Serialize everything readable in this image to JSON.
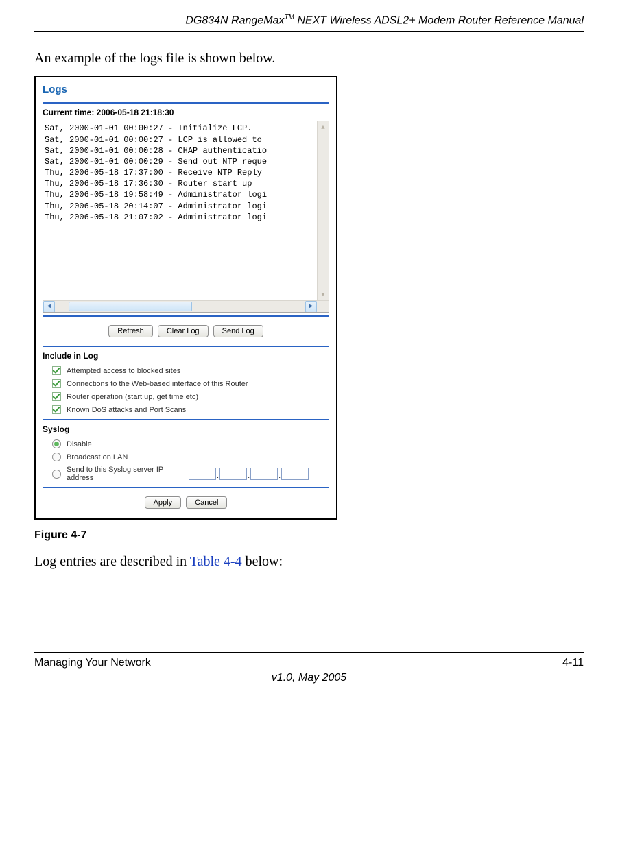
{
  "header": {
    "title_pre": "DG834N RangeMax",
    "title_tm": "TM",
    "title_post": " NEXT Wireless ADSL2+ Modem Router Reference Manual"
  },
  "intro_text": "An example of the logs file is shown below.",
  "panel": {
    "title": "Logs",
    "current_time_label": "Current time: 2006-05-18 21:18:30",
    "log_lines": [
      "Sat, 2000-01-01 00:00:27 - Initialize LCP.",
      "Sat, 2000-01-01 00:00:27 - LCP is allowed to",
      "Sat, 2000-01-01 00:00:28 - CHAP authenticatio",
      "Sat, 2000-01-01 00:00:29 - Send out NTP reque",
      "Thu, 2006-05-18 17:37:00 - Receive NTP Reply",
      "Thu, 2006-05-18 17:36:30 - Router start up",
      "Thu, 2006-05-18 19:58:49 - Administrator logi",
      "Thu, 2006-05-18 20:14:07 - Administrator logi",
      "Thu, 2006-05-18 21:07:02 - Administrator logi"
    ],
    "buttons": {
      "refresh": "Refresh",
      "clear": "Clear Log",
      "send": "Send Log"
    },
    "include_label": "Include in Log",
    "include_options": [
      "Attempted access to blocked sites",
      "Connections to the Web-based interface of this Router",
      "Router operation (start up, get time etc)",
      "Known DoS attacks and Port Scans"
    ],
    "syslog_label": "Syslog",
    "syslog_options": {
      "disable": "Disable",
      "broadcast": "Broadcast on LAN",
      "send_ip": "Send to this Syslog server IP address"
    },
    "bottom_buttons": {
      "apply": "Apply",
      "cancel": "Cancel"
    }
  },
  "caption": "Figure 4-7",
  "closing_pre": "Log entries are described in ",
  "closing_link": "Table 4-4",
  "closing_post": " below:",
  "footer": {
    "left": "Managing Your Network",
    "right": "4-11",
    "version": "v1.0, May 2005"
  }
}
